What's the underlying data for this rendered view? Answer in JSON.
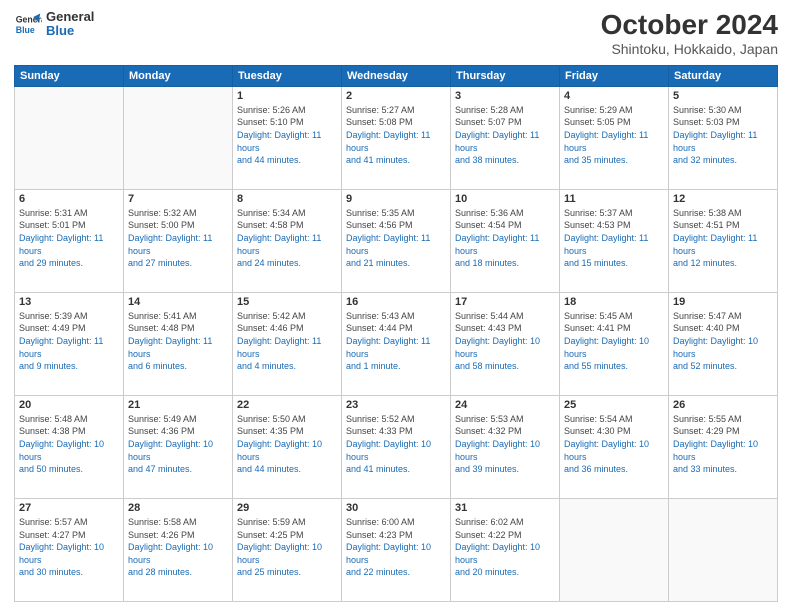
{
  "header": {
    "logo_line1": "General",
    "logo_line2": "Blue",
    "title": "October 2024",
    "subtitle": "Shintoku, Hokkaido, Japan"
  },
  "weekdays": [
    "Sunday",
    "Monday",
    "Tuesday",
    "Wednesday",
    "Thursday",
    "Friday",
    "Saturday"
  ],
  "weeks": [
    [
      {
        "day": "",
        "info": ""
      },
      {
        "day": "",
        "info": ""
      },
      {
        "day": "1",
        "rise": "Sunrise: 5:26 AM",
        "set": "Sunset: 5:10 PM",
        "daylight": "Daylight: 11 hours and 44 minutes."
      },
      {
        "day": "2",
        "rise": "Sunrise: 5:27 AM",
        "set": "Sunset: 5:08 PM",
        "daylight": "Daylight: 11 hours and 41 minutes."
      },
      {
        "day": "3",
        "rise": "Sunrise: 5:28 AM",
        "set": "Sunset: 5:07 PM",
        "daylight": "Daylight: 11 hours and 38 minutes."
      },
      {
        "day": "4",
        "rise": "Sunrise: 5:29 AM",
        "set": "Sunset: 5:05 PM",
        "daylight": "Daylight: 11 hours and 35 minutes."
      },
      {
        "day": "5",
        "rise": "Sunrise: 5:30 AM",
        "set": "Sunset: 5:03 PM",
        "daylight": "Daylight: 11 hours and 32 minutes."
      }
    ],
    [
      {
        "day": "6",
        "rise": "Sunrise: 5:31 AM",
        "set": "Sunset: 5:01 PM",
        "daylight": "Daylight: 11 hours and 29 minutes."
      },
      {
        "day": "7",
        "rise": "Sunrise: 5:32 AM",
        "set": "Sunset: 5:00 PM",
        "daylight": "Daylight: 11 hours and 27 minutes."
      },
      {
        "day": "8",
        "rise": "Sunrise: 5:34 AM",
        "set": "Sunset: 4:58 PM",
        "daylight": "Daylight: 11 hours and 24 minutes."
      },
      {
        "day": "9",
        "rise": "Sunrise: 5:35 AM",
        "set": "Sunset: 4:56 PM",
        "daylight": "Daylight: 11 hours and 21 minutes."
      },
      {
        "day": "10",
        "rise": "Sunrise: 5:36 AM",
        "set": "Sunset: 4:54 PM",
        "daylight": "Daylight: 11 hours and 18 minutes."
      },
      {
        "day": "11",
        "rise": "Sunrise: 5:37 AM",
        "set": "Sunset: 4:53 PM",
        "daylight": "Daylight: 11 hours and 15 minutes."
      },
      {
        "day": "12",
        "rise": "Sunrise: 5:38 AM",
        "set": "Sunset: 4:51 PM",
        "daylight": "Daylight: 11 hours and 12 minutes."
      }
    ],
    [
      {
        "day": "13",
        "rise": "Sunrise: 5:39 AM",
        "set": "Sunset: 4:49 PM",
        "daylight": "Daylight: 11 hours and 9 minutes."
      },
      {
        "day": "14",
        "rise": "Sunrise: 5:41 AM",
        "set": "Sunset: 4:48 PM",
        "daylight": "Daylight: 11 hours and 6 minutes."
      },
      {
        "day": "15",
        "rise": "Sunrise: 5:42 AM",
        "set": "Sunset: 4:46 PM",
        "daylight": "Daylight: 11 hours and 4 minutes."
      },
      {
        "day": "16",
        "rise": "Sunrise: 5:43 AM",
        "set": "Sunset: 4:44 PM",
        "daylight": "Daylight: 11 hours and 1 minute."
      },
      {
        "day": "17",
        "rise": "Sunrise: 5:44 AM",
        "set": "Sunset: 4:43 PM",
        "daylight": "Daylight: 10 hours and 58 minutes."
      },
      {
        "day": "18",
        "rise": "Sunrise: 5:45 AM",
        "set": "Sunset: 4:41 PM",
        "daylight": "Daylight: 10 hours and 55 minutes."
      },
      {
        "day": "19",
        "rise": "Sunrise: 5:47 AM",
        "set": "Sunset: 4:40 PM",
        "daylight": "Daylight: 10 hours and 52 minutes."
      }
    ],
    [
      {
        "day": "20",
        "rise": "Sunrise: 5:48 AM",
        "set": "Sunset: 4:38 PM",
        "daylight": "Daylight: 10 hours and 50 minutes."
      },
      {
        "day": "21",
        "rise": "Sunrise: 5:49 AM",
        "set": "Sunset: 4:36 PM",
        "daylight": "Daylight: 10 hours and 47 minutes."
      },
      {
        "day": "22",
        "rise": "Sunrise: 5:50 AM",
        "set": "Sunset: 4:35 PM",
        "daylight": "Daylight: 10 hours and 44 minutes."
      },
      {
        "day": "23",
        "rise": "Sunrise: 5:52 AM",
        "set": "Sunset: 4:33 PM",
        "daylight": "Daylight: 10 hours and 41 minutes."
      },
      {
        "day": "24",
        "rise": "Sunrise: 5:53 AM",
        "set": "Sunset: 4:32 PM",
        "daylight": "Daylight: 10 hours and 39 minutes."
      },
      {
        "day": "25",
        "rise": "Sunrise: 5:54 AM",
        "set": "Sunset: 4:30 PM",
        "daylight": "Daylight: 10 hours and 36 minutes."
      },
      {
        "day": "26",
        "rise": "Sunrise: 5:55 AM",
        "set": "Sunset: 4:29 PM",
        "daylight": "Daylight: 10 hours and 33 minutes."
      }
    ],
    [
      {
        "day": "27",
        "rise": "Sunrise: 5:57 AM",
        "set": "Sunset: 4:27 PM",
        "daylight": "Daylight: 10 hours and 30 minutes."
      },
      {
        "day": "28",
        "rise": "Sunrise: 5:58 AM",
        "set": "Sunset: 4:26 PM",
        "daylight": "Daylight: 10 hours and 28 minutes."
      },
      {
        "day": "29",
        "rise": "Sunrise: 5:59 AM",
        "set": "Sunset: 4:25 PM",
        "daylight": "Daylight: 10 hours and 25 minutes."
      },
      {
        "day": "30",
        "rise": "Sunrise: 6:00 AM",
        "set": "Sunset: 4:23 PM",
        "daylight": "Daylight: 10 hours and 22 minutes."
      },
      {
        "day": "31",
        "rise": "Sunrise: 6:02 AM",
        "set": "Sunset: 4:22 PM",
        "daylight": "Daylight: 10 hours and 20 minutes."
      },
      {
        "day": "",
        "info": ""
      },
      {
        "day": "",
        "info": ""
      }
    ]
  ]
}
